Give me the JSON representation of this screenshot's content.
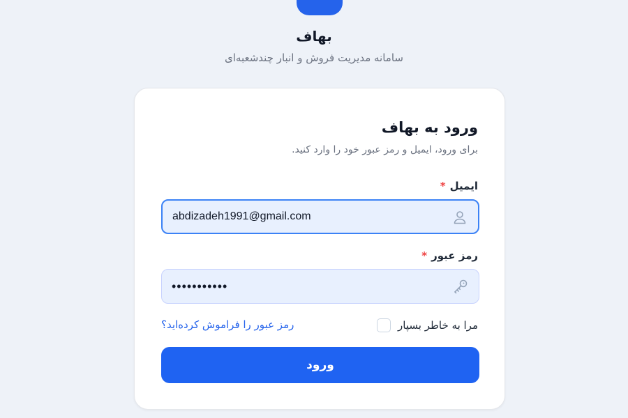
{
  "brand": {
    "title": "بهاف",
    "subtitle": "سامانه مدیریت فروش و انبار چندشعبه‌ای"
  },
  "login_card": {
    "title": "ورود به بهاف",
    "subtitle": "برای ورود، ایمیل و رمز عبور خود را وارد کنید."
  },
  "email_field": {
    "label": "ایمیل",
    "required_mark": "*",
    "value": "abdizadeh1991@gmail.com",
    "icon": "user-icon"
  },
  "password_field": {
    "label": "رمز عبور",
    "required_mark": "*",
    "value": "•••••••••••",
    "icon": "key-icon"
  },
  "remember_me": {
    "label": "مرا به خاطر بسپار",
    "checked": false
  },
  "forgot_password": {
    "label": "رمز عبور را فراموش کرده‌اید؟"
  },
  "submit": {
    "label": "ورود"
  },
  "colors": {
    "accent": "#1f63f2",
    "required": "#ef4444",
    "background": "#eef2f8"
  }
}
